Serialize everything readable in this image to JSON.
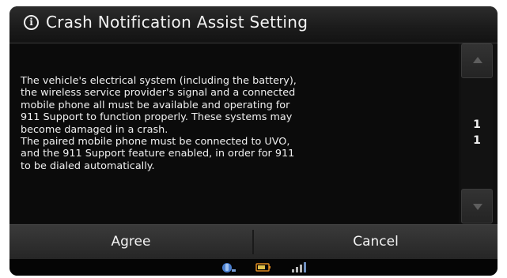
{
  "dialog": {
    "title_icon": "info-icon",
    "title_icon_glyph": "i",
    "title": "Crash Notification Assist Setting",
    "message": "The vehicle's electrical system (including the battery),\nthe wireless service provider's signal and a connected\nmobile phone all must be available and operating for\n911 Support to function properly. These systems may\nbecome damaged in a crash.\nThe paired mobile phone must be connected to UVO,\nand the 911 Support feature enabled, in order for 911\nto be dialed automatically."
  },
  "scrollbar": {
    "up_icon": "scroll-up-icon",
    "down_icon": "scroll-down-icon",
    "current_page": "1",
    "total_pages": "1"
  },
  "buttons": {
    "agree_label": "Agree",
    "cancel_label": "Cancel"
  },
  "status_bar": {
    "icons": [
      "bluetooth-phone-icon",
      "battery-icon",
      "signal-strength-icon"
    ]
  },
  "colors": {
    "background": "#101010",
    "text": "#f0f0f0",
    "button_bar": "#2e2e2e",
    "status_blue": "#4a7fd0",
    "battery_orange": "#e08a1e"
  }
}
